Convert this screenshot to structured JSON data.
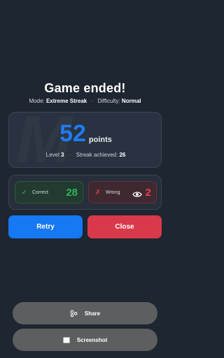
{
  "header": {
    "title": "Game ended!",
    "mode_label": "Mode:",
    "mode_value": "Extreme Streak",
    "separator": "·",
    "difficulty_label": "Difficulty:",
    "difficulty_value": "Normal"
  },
  "score": {
    "value": "52",
    "unit": "points",
    "level_label": "Level",
    "level_value": "3",
    "separator": "·",
    "streak_label": "Streak achieved:",
    "streak_value": "26"
  },
  "results": {
    "correct_label": "Correct",
    "correct_count": "28",
    "wrong_label": "Wrong",
    "wrong_count": "2"
  },
  "buttons": {
    "retry": "Retry",
    "close": "Close",
    "share": "Share",
    "screenshot": "Screenshot"
  },
  "icons": {
    "correct": "check-icon",
    "wrong": "x-icon",
    "review": "eye-icon",
    "share": "share-icon",
    "screenshot": "screenshot-icon"
  },
  "colors": {
    "background": "#1e2631",
    "accent": "#1678f2",
    "correct": "#2fb65a",
    "wrong": "#d9394a",
    "action_button": "#5d5e60"
  }
}
